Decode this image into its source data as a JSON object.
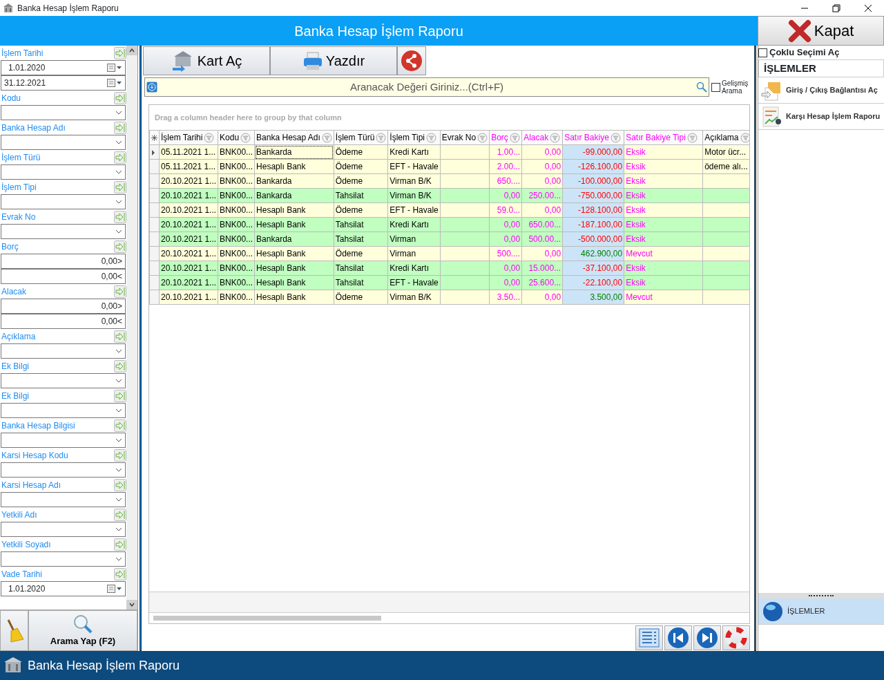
{
  "window": {
    "title": "Banka Hesap İşlem Raporu"
  },
  "header": {
    "title": "Banka Hesap İşlem Raporu",
    "close_button": "Kapat"
  },
  "filters": [
    {
      "label": "İşlem Tarihi",
      "kind": "date",
      "values": [
        "1.01.2020",
        "31.12.2021"
      ]
    },
    {
      "label": "Kodu",
      "kind": "combo"
    },
    {
      "label": "Banka Hesap Adı",
      "kind": "combo"
    },
    {
      "label": "İşlem Türü",
      "kind": "combo"
    },
    {
      "label": "İşlem Tipi",
      "kind": "combo"
    },
    {
      "label": "Evrak No",
      "kind": "combo"
    },
    {
      "label": "Borç",
      "kind": "range",
      "values": [
        "0,00>",
        "0,00<"
      ]
    },
    {
      "label": "Alacak",
      "kind": "range",
      "values": [
        "0,00>",
        "0,00<"
      ]
    },
    {
      "label": "Açıklama",
      "kind": "combo"
    },
    {
      "label": "Ek Bilgi",
      "kind": "combo"
    },
    {
      "label": "Ek Bilgi",
      "kind": "combo"
    },
    {
      "label": "Banka Hesap Bilgisi",
      "kind": "combo"
    },
    {
      "label": "Karsi Hesap Kodu",
      "kind": "combo"
    },
    {
      "label": "Karsi Hesap Adı",
      "kind": "combo"
    },
    {
      "label": "Yetkili Adı",
      "kind": "combo"
    },
    {
      "label": "Yetkili Soyadı",
      "kind": "combo"
    },
    {
      "label": "Vade Tarihi",
      "kind": "date",
      "values": [
        "1.01.2020"
      ]
    }
  ],
  "search_button": "Arama Yap (F2)",
  "toolbar": {
    "card_button": "Kart Aç",
    "print_button": "Yazdır"
  },
  "search": {
    "placeholder": "Aranacak Değeri Giriniz...(Ctrl+F)",
    "advanced_label": "Gelişmiş Arama",
    "advanced_checked": false
  },
  "grid": {
    "group_hint": "Drag a column header here to group by that column",
    "columns": [
      {
        "label": "İşlem Tarihi",
        "color": "#000000",
        "shaded": false
      },
      {
        "label": "Kodu",
        "color": "#000000",
        "shaded": false
      },
      {
        "label": "Banka Hesap Adı",
        "color": "#000000",
        "shaded": false
      },
      {
        "label": "İşlem Türü",
        "color": "#000000",
        "shaded": false
      },
      {
        "label": "İşlem Tipi",
        "color": "#000000",
        "shaded": false
      },
      {
        "label": "Evrak No",
        "color": "#000000",
        "shaded": false
      },
      {
        "label": "Borç",
        "color": "#ff00ff",
        "shaded": false
      },
      {
        "label": "Alacak",
        "color": "#ff00ff",
        "shaded": false
      },
      {
        "label": "Satır Bakiye",
        "color": "#ff00ff",
        "shaded": true
      },
      {
        "label": "Satır Bakiye Tipi",
        "color": "#ff00ff",
        "shaded": false
      },
      {
        "label": "Açıklama",
        "color": "#000000",
        "shaded": false
      }
    ],
    "rows": [
      {
        "selected": true,
        "color": "#ffffdc",
        "cells": [
          "05.11.2021 1...",
          "BNK00...",
          "Bankarda",
          "Ödeme",
          "Kredi Kartı",
          null,
          "1.00...",
          "0,00",
          {
            "text": "-99.000,00",
            "color": "#ff0000"
          },
          "Eksik",
          "Motor ücr..."
        ]
      },
      {
        "selected": false,
        "color": "#ffffdc",
        "cells": [
          "05.11.2021 1...",
          "BNK00...",
          "Hesaplı Bank",
          "Ödeme",
          "EFT - Havale",
          null,
          "2.00...",
          "0,00",
          {
            "text": "-126.100,00",
            "color": "#ff0000"
          },
          "Eksik",
          "ödeme alı..."
        ]
      },
      {
        "selected": false,
        "color": "#ffffdc",
        "cells": [
          "20.10.2021 1...",
          "BNK00...",
          "Bankarda",
          "Ödeme",
          "Virman B/K",
          null,
          "650....",
          "0,00",
          {
            "text": "-100.000,00",
            "color": "#ff0000"
          },
          "Eksik",
          null
        ]
      },
      {
        "selected": false,
        "color": "#c0ffc0",
        "cells": [
          "20.10.2021 1...",
          "BNK00...",
          "Bankarda",
          "Tahsilat",
          "Virman B/K",
          null,
          "0,00",
          "250.00...",
          {
            "text": "-750.000,00",
            "color": "#ff0000"
          },
          "Eksik",
          null
        ]
      },
      {
        "selected": false,
        "color": "#ffffdc",
        "cells": [
          "20.10.2021 1...",
          "BNK00...",
          "Hesaplı Bank",
          "Ödeme",
          "EFT - Havale",
          null,
          "59.0...",
          "0,00",
          {
            "text": "-128.100,00",
            "color": "#ff0000"
          },
          "Eksik",
          null
        ]
      },
      {
        "selected": false,
        "color": "#c0ffc0",
        "cells": [
          "20.10.2021 1...",
          "BNK00...",
          "Hesaplı Bank",
          "Tahsilat",
          "Kredi Kartı",
          null,
          "0,00",
          "650.00...",
          {
            "text": "-187.100,00",
            "color": "#ff0000"
          },
          "Eksik",
          null
        ]
      },
      {
        "selected": false,
        "color": "#c0ffc0",
        "cells": [
          "20.10.2021 1...",
          "BNK00...",
          "Bankarda",
          "Tahsilat",
          "Virman",
          null,
          "0,00",
          "500.00...",
          {
            "text": "-500.000,00",
            "color": "#ff0000"
          },
          "Eksik",
          null
        ]
      },
      {
        "selected": false,
        "color": "#ffffdc",
        "cells": [
          "20.10.2021 1...",
          "BNK00...",
          "Hesaplı Bank",
          "Ödeme",
          "Virman",
          null,
          "500....",
          "0,00",
          {
            "text": "462.900,00",
            "color": "#008000"
          },
          "Mevcut",
          null
        ]
      },
      {
        "selected": false,
        "color": "#c0ffc0",
        "cells": [
          "20.10.2021 1...",
          "BNK00...",
          "Hesaplı Bank",
          "Tahsilat",
          "Kredi Kartı",
          null,
          "0,00",
          "15.000...",
          {
            "text": "-37.100,00",
            "color": "#ff0000"
          },
          "Eksik",
          null
        ]
      },
      {
        "selected": false,
        "color": "#c0ffc0",
        "cells": [
          "20.10.2021 1...",
          "BNK00...",
          "Hesaplı Bank",
          "Tahsilat",
          "EFT - Havale",
          null,
          "0,00",
          "25.600...",
          {
            "text": "-22.100,00",
            "color": "#ff0000"
          },
          "Eksik",
          null
        ]
      },
      {
        "selected": false,
        "color": "#ffffdc",
        "cells": [
          "20.10.2021 1...",
          "BNK00...",
          "Hesaplı Bank",
          "Ödeme",
          "Virman B/K",
          null,
          "3.50...",
          "0,00",
          {
            "text": "3.500,00",
            "color": "#008000"
          },
          "Mevcut",
          null
        ]
      }
    ]
  },
  "side": {
    "multi_select_label": "Çoklu Seçimi Aç",
    "multi_select_checked": false,
    "title": "İŞLEMLER",
    "actions": [
      {
        "label": "Giriş / Çıkış Bağlantısı Aç",
        "kind": "link"
      },
      {
        "label": "Karşı Hesap İşlem Raporu",
        "kind": "report"
      }
    ],
    "groups": [
      {
        "label": "İŞLEMLER",
        "selected": true
      }
    ]
  },
  "taskbar": {
    "title": "Banka Hesap İşlem Raporu"
  }
}
